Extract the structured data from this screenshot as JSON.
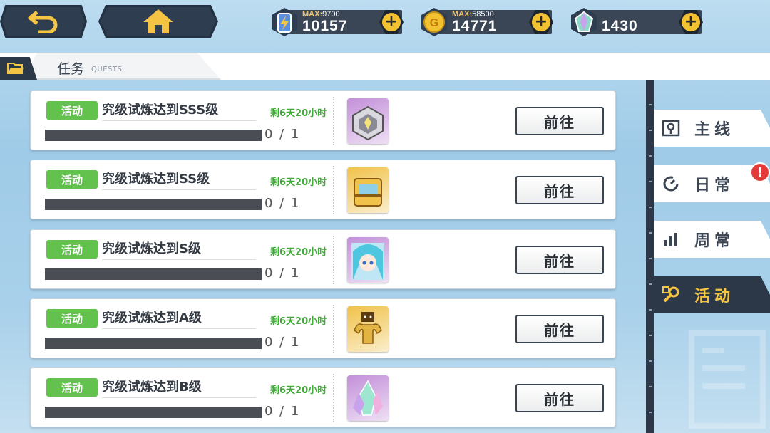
{
  "top_bar": {
    "resources": [
      {
        "icon": "energy-battery-icon",
        "max_label": "MAX:",
        "max_value": "9700",
        "value": "10157"
      },
      {
        "icon": "gold-coin-icon",
        "max_label": "MAX:",
        "max_value": "58500",
        "value": "14771"
      },
      {
        "icon": "crystal-gem-icon",
        "value": "1430"
      }
    ]
  },
  "header": {
    "title": "任务",
    "subtitle": "QUESTS"
  },
  "quests": [
    {
      "badge": "活动",
      "title": "究级试炼达到SSS级",
      "time_left": "剩6天20小时",
      "progress": "0 / 1",
      "progress_value": 0,
      "reward_icon": "silver-chest-icon",
      "reward_color": "#c38fd9",
      "button": "前往"
    },
    {
      "badge": "活动",
      "title": "究级试炼达到SS级",
      "time_left": "剩6天20小时",
      "progress": "0 / 1",
      "progress_value": 0,
      "reward_icon": "gold-chest-icon",
      "reward_color": "#f0c24a",
      "button": "前往"
    },
    {
      "badge": "活动",
      "title": "究级试炼达到S级",
      "time_left": "剩6天20小时",
      "progress": "0 / 1",
      "progress_value": 0,
      "reward_icon": "character-portrait-icon",
      "reward_color": "#c38fd9",
      "button": "前往"
    },
    {
      "badge": "活动",
      "title": "究级试炼达到A级",
      "time_left": "剩6天20小时",
      "progress": "0 / 1",
      "progress_value": 0,
      "reward_icon": "muscle-figure-icon",
      "reward_color": "#f0c24a",
      "button": "前往"
    },
    {
      "badge": "活动",
      "title": "究级试炼达到B级",
      "time_left": "剩6天20小时",
      "progress": "0 / 1",
      "progress_value": 0,
      "reward_icon": "crystal-cluster-icon",
      "reward_color": "#c38fd9",
      "button": "前往"
    }
  ],
  "tabs": [
    {
      "label": "主线",
      "icon": "map-pin-icon",
      "active": false
    },
    {
      "label": "日常",
      "icon": "refresh-icon",
      "active": false,
      "alert": "!"
    },
    {
      "label": "周常",
      "icon": "bar-chart-icon",
      "active": false
    },
    {
      "label": "活动",
      "icon": "wrench-icon",
      "active": true
    }
  ],
  "colors": {
    "accent_yellow": "#f6c443",
    "badge_green": "#63c14e",
    "timer_green": "#42a93a",
    "dark_panel": "#2c3847"
  }
}
